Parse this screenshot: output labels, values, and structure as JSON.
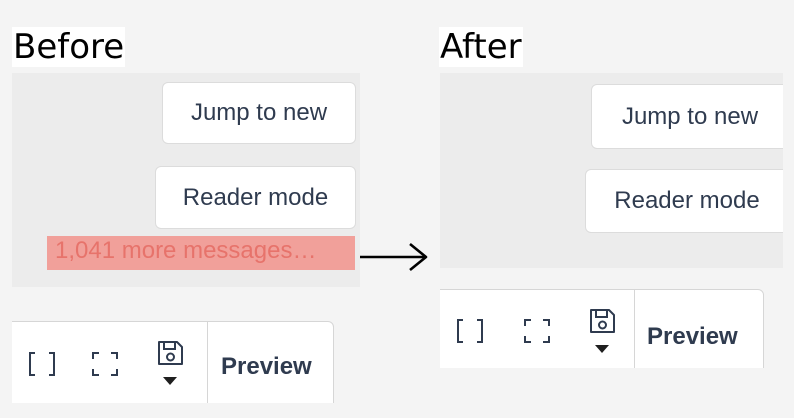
{
  "before": {
    "title": "Before",
    "jump_button": "Jump to new",
    "reader_button": "Reader mode",
    "more_messages": "1,041 more messages…",
    "preview_label": "Preview"
  },
  "after": {
    "title": "After",
    "jump_button": "Jump to new",
    "reader_button": "Reader mode",
    "preview_label": "Preview"
  },
  "icons": [
    "bracket-icon",
    "fullscreen-icon",
    "save-icon",
    "dropdown-caret-icon",
    "right-arrow-icon"
  ],
  "colors": {
    "highlight": "#f1a09a",
    "highlight_text": "#e7736b",
    "button_text": "#2f3b4f",
    "pane_background": "#ececec"
  }
}
